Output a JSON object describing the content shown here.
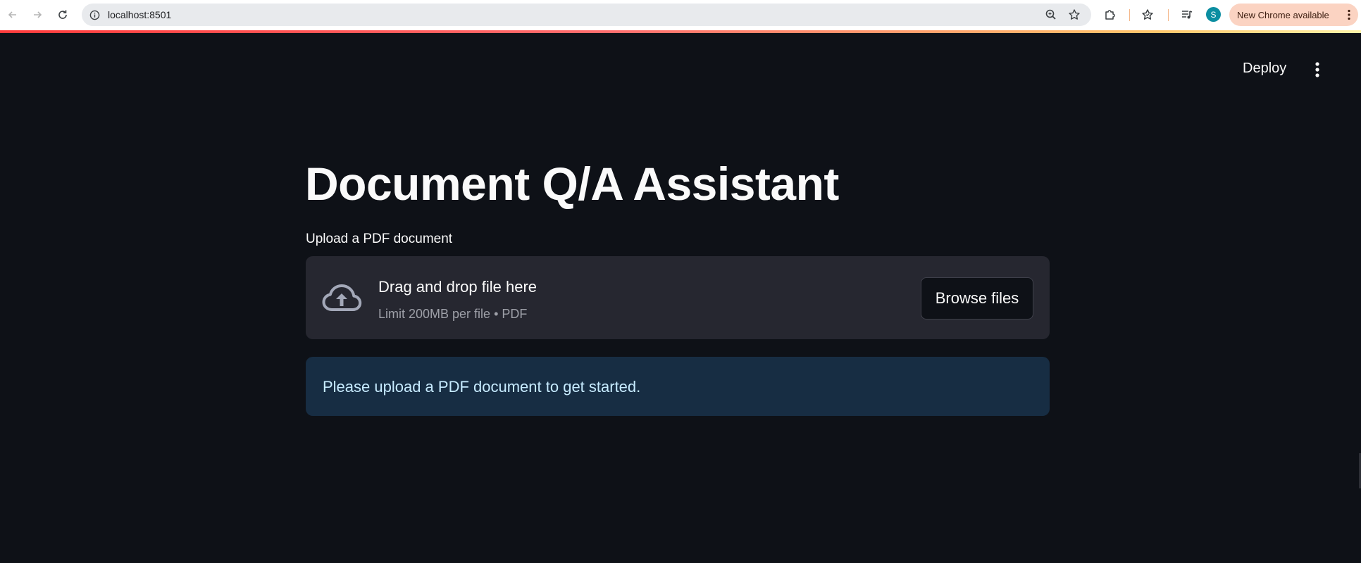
{
  "browser": {
    "url": "localhost:8501",
    "avatar_initial": "S",
    "update_label": "New Chrome available",
    "icons": {
      "back": "arrow-left-icon",
      "forward": "arrow-right-icon",
      "reload": "reload-icon",
      "site_info": "info-icon",
      "zoom": "zoom-icon",
      "bookmark": "star-icon",
      "extensions": "puzzle-icon",
      "bookmarks_manager": "star-list-icon",
      "media": "media-control-icon",
      "menu": "kebab-menu-icon"
    },
    "colors": {
      "toolbar_bg": "#ffffff",
      "omnibox_bg": "#e8eaed",
      "update_pill_bg": "#fbd3c2",
      "avatar_bg": "#0b8ea1"
    }
  },
  "app": {
    "header": {
      "deploy_label": "Deploy",
      "menu_icon": "kebab-menu-icon"
    },
    "title": "Document Q/A Assistant",
    "uploader": {
      "label": "Upload a PDF document",
      "drop_text": "Drag and drop file here",
      "limit_text": "Limit 200MB per file • PDF",
      "browse_label": "Browse files",
      "icon": "cloud-upload-icon"
    },
    "info_message": "Please upload a PDF document to get started.",
    "colors": {
      "background": "#0e1117",
      "dropzone_bg": "#262730",
      "info_bg": "#172d43",
      "info_text": "#c7ebff",
      "accent_stripe": "#ff4b4b"
    }
  }
}
